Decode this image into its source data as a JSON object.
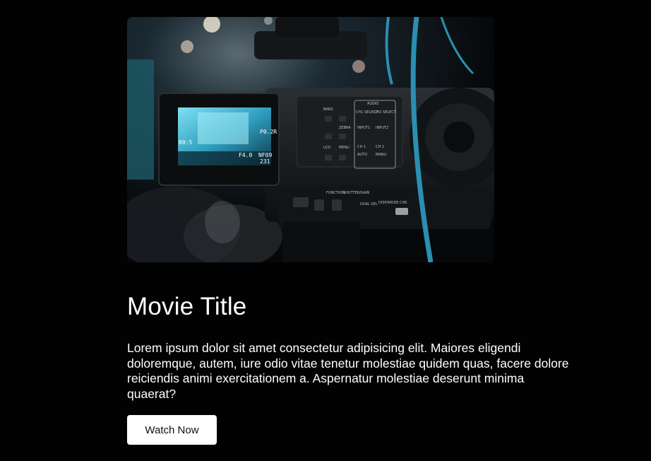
{
  "hero": {
    "image_alt": "Video camera with flip-out monitor at a live event",
    "camera_labels": {
      "audio": "AUDIO",
      "ch1_select": "CH1 SELECT",
      "ch2_select": "CH2 SELECT",
      "input1": "INPUT1",
      "input2": "INPUT2",
      "ch1": "CH 1",
      "ch2": "CH 2",
      "auto": "AUTO",
      "manu": "MANU",
      "bars": "BARS",
      "zebra": "ZEBRA",
      "function": "FUNCTION",
      "shutter": "SHUTTER/GAIN",
      "lcd": "LCD",
      "menu": "MENU",
      "disp": "DISP/MODE CHK",
      "dual": "DUAL SEL",
      "f_value": "F4.0",
      "nf": "NF09",
      "num": "231",
      "shot": "P0.2R",
      "tc": "00:5"
    }
  },
  "movie": {
    "title": "Movie Title",
    "description": "Lorem ipsum dolor sit amet consectetur adipisicing elit. Maiores eligendi doloremque, autem, iure odio vitae tenetur molestiae quidem quas, facere dolore reiciendis animi exercitationem a. Aspernatur molestiae deserunt minima quaerat?"
  },
  "actions": {
    "watch_now_label": "Watch Now"
  },
  "colors": {
    "background": "#020202",
    "text": "#ffffff",
    "button_bg": "#ffffff",
    "button_text": "#111111",
    "screen_cyan": "#3fb8d8"
  }
}
